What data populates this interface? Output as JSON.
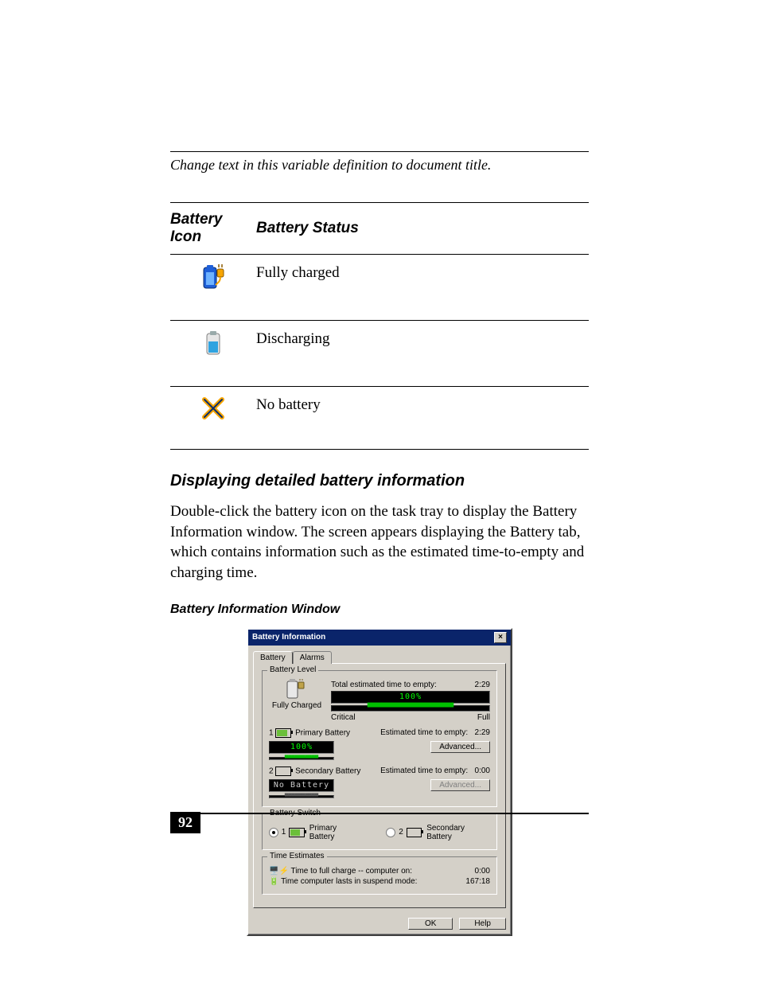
{
  "header_text": "Change text in this variable definition to document title.",
  "table": {
    "head_icon": "Battery Icon",
    "head_status": "Battery Status",
    "rows": [
      {
        "icon": "battery-full-plug",
        "status": "Fully charged"
      },
      {
        "icon": "battery-discharging",
        "status": "Discharging"
      },
      {
        "icon": "no-battery",
        "status": "No battery"
      }
    ]
  },
  "section_heading": "Displaying detailed battery information",
  "body": "Double-click the battery icon on the task tray to display the Battery Information window. The screen appears displaying the Battery tab, which contains information such as the estimated time-to-empty and charging time.",
  "figure_caption": "Battery Information Window",
  "dialog": {
    "title": "Battery Information",
    "tabs": {
      "battery": "Battery",
      "alarms": "Alarms"
    },
    "battery_level": {
      "legend": "Battery Level",
      "status": "Fully Charged",
      "total_label": "Total estimated time to empty:",
      "total_value": "2:29",
      "pct": "100%",
      "scale_low": "Critical",
      "scale_high": "Full"
    },
    "primary": {
      "num": "1",
      "label": "Primary Battery",
      "est_label": "Estimated time to empty:",
      "est_val": "2:29",
      "pct": "100%",
      "adv": "Advanced..."
    },
    "secondary": {
      "num": "2",
      "label": "Secondary Battery",
      "est_label": "Estimated time to empty:",
      "est_val": "0:00",
      "pct": "No Battery",
      "adv": "Advanced..."
    },
    "switch": {
      "legend": "Battery Switch",
      "opt1": "Primary Battery",
      "opt1_num": "1",
      "opt2": "Secondary Battery",
      "opt2_num": "2"
    },
    "time": {
      "legend": "Time Estimates",
      "l1": "Time to full charge -- computer on:",
      "v1": "0:00",
      "l2": "Time computer lasts in suspend mode:",
      "v2": "167:18"
    },
    "ok": "OK",
    "help": "Help"
  },
  "page_number": "92"
}
